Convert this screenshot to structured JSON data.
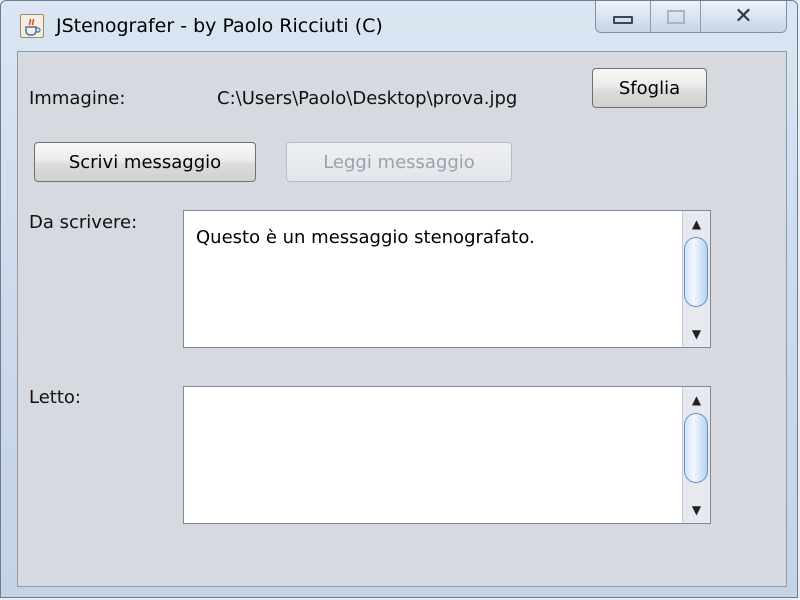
{
  "window": {
    "title": "JStenografer - by Paolo Ricciuti (C)",
    "controls": {
      "minimize": "minimize",
      "maximize": "maximize",
      "close": "✕"
    }
  },
  "image_row": {
    "label": "Immagine:",
    "path": "C:\\Users\\Paolo\\Desktop\\prova.jpg",
    "browse_label": "Sfoglia"
  },
  "actions": {
    "write_label": "Scrivi messaggio",
    "read_label": "Leggi messaggio",
    "read_enabled": false
  },
  "write_section": {
    "label": "Da scrivere:",
    "text": "Questo è un messaggio stenografato."
  },
  "read_section": {
    "label": "Letto:",
    "text": ""
  },
  "icons": {
    "app": "java-cup-icon",
    "scroll_up": "arrow-up-icon",
    "scroll_down": "arrow-down-icon"
  }
}
